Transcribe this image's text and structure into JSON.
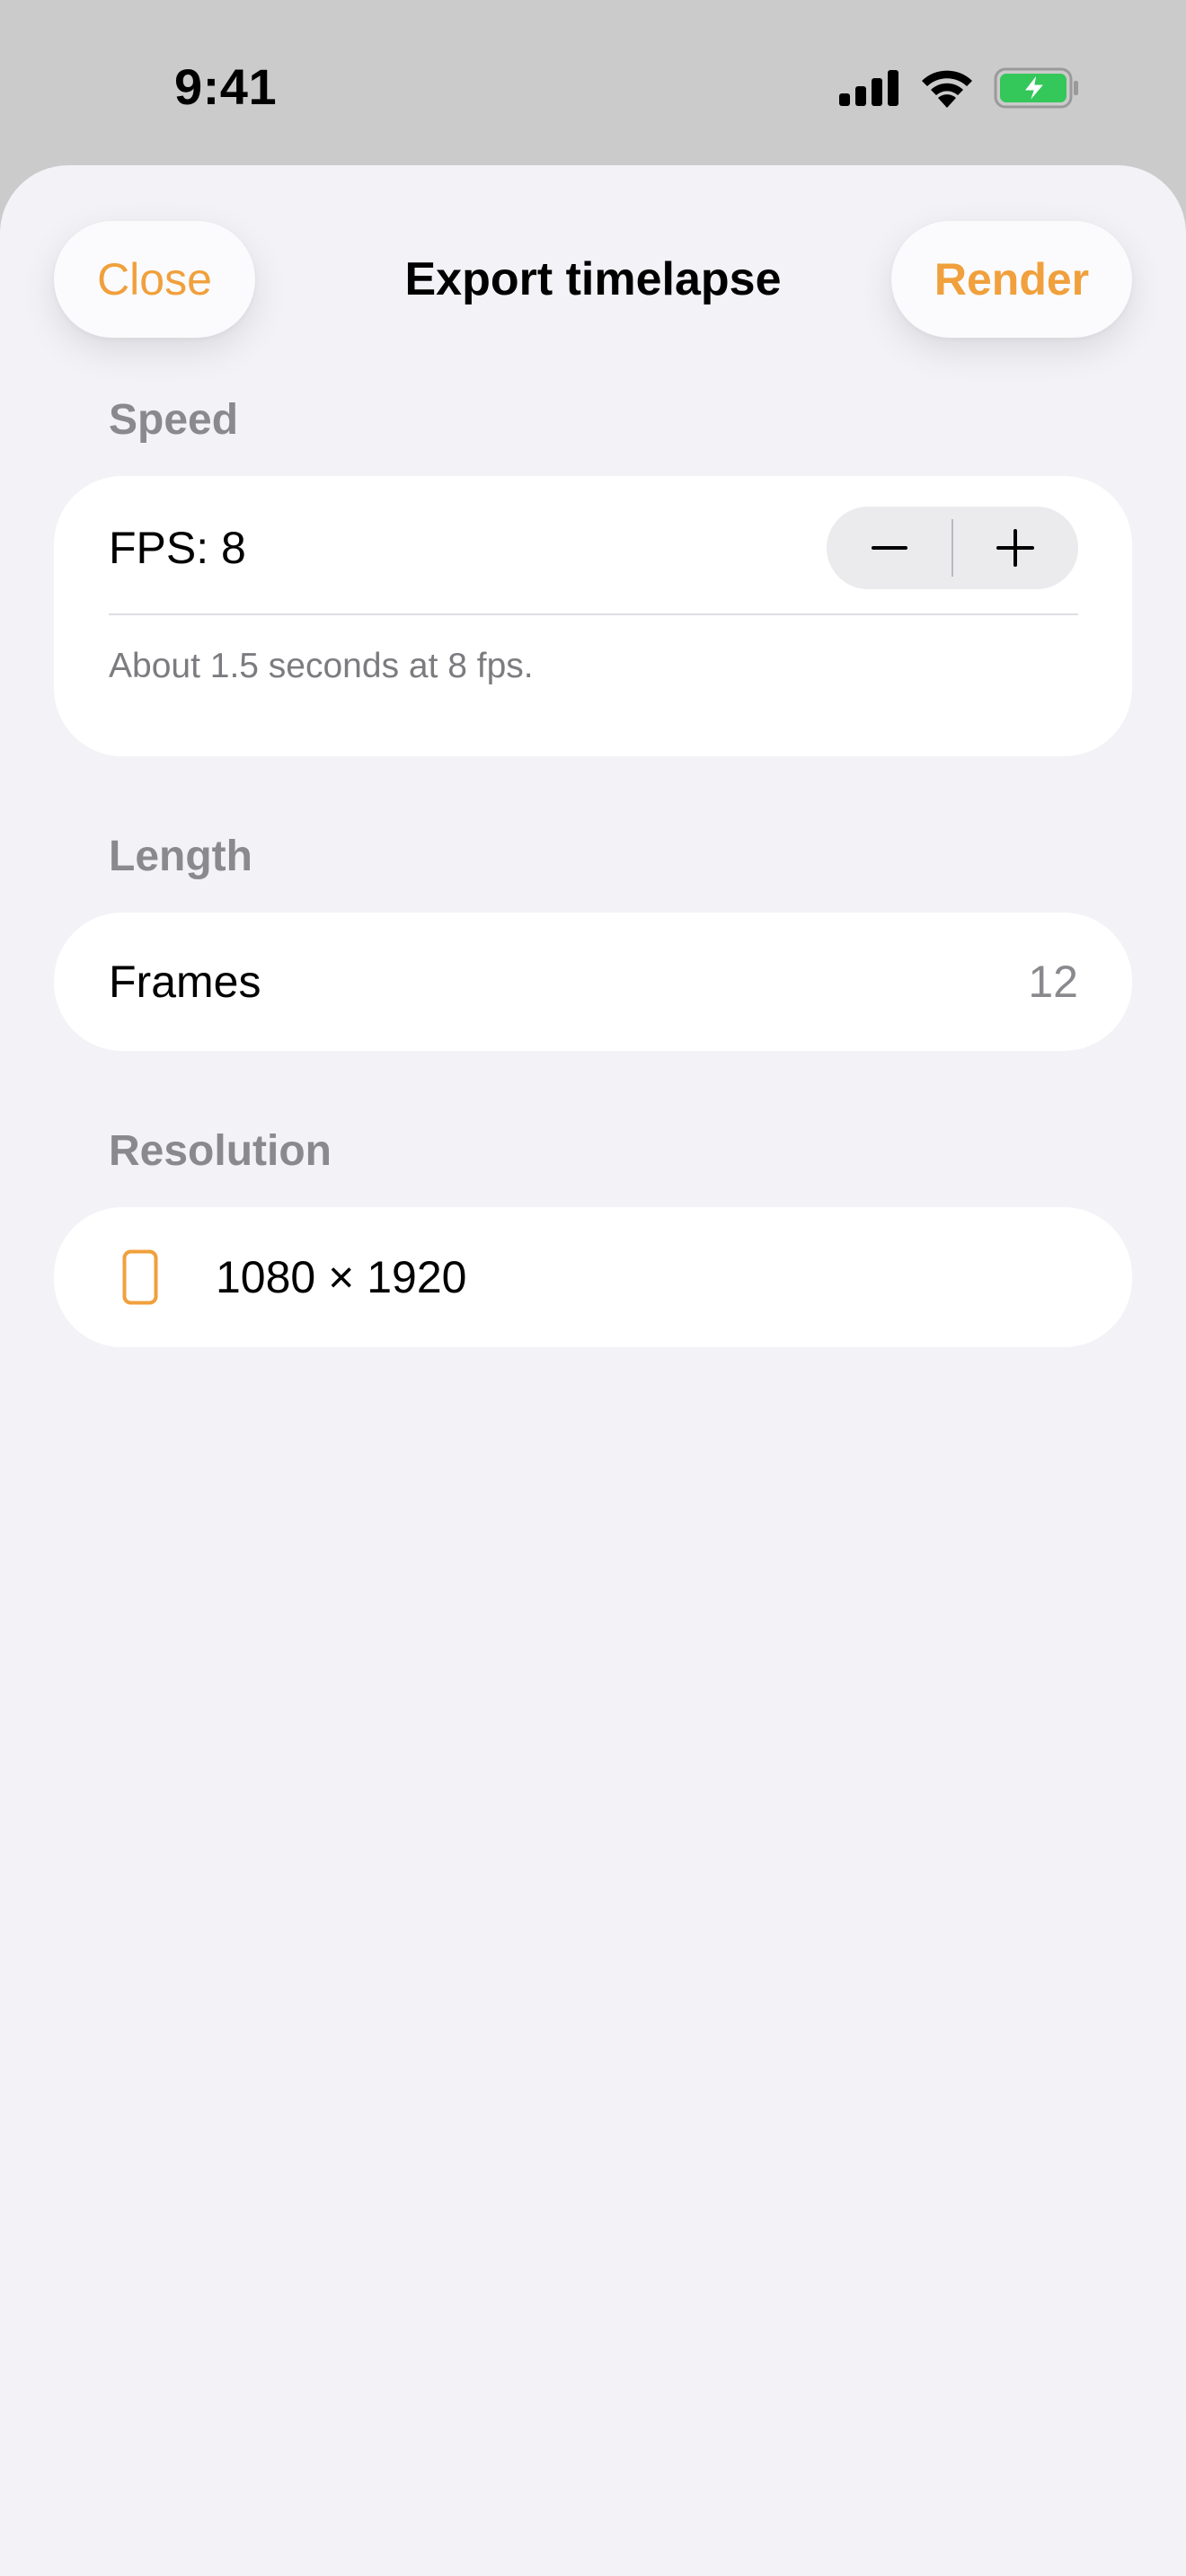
{
  "status_bar": {
    "time": "9:41",
    "icons": [
      "cellular-signal-icon",
      "wifi-icon",
      "battery-charging-icon"
    ]
  },
  "nav": {
    "close_label": "Close",
    "title": "Export timelapse",
    "render_label": "Render"
  },
  "sections": {
    "speed": {
      "header": "Speed",
      "fps_label": "FPS: 8",
      "footnote": "About 1.5 seconds at 8 fps."
    },
    "length": {
      "header": "Length",
      "frames_label": "Frames",
      "frames_value": "12"
    },
    "resolution": {
      "header": "Resolution",
      "value": "1080 × 1920",
      "icon": "phone-portrait-icon"
    }
  },
  "colors": {
    "accent": "#f0a03c",
    "battery_green": "#34c759",
    "sheet_background": "#f2f2f7",
    "card_background": "#ffffff",
    "secondary_text": "#8a8a8e"
  }
}
